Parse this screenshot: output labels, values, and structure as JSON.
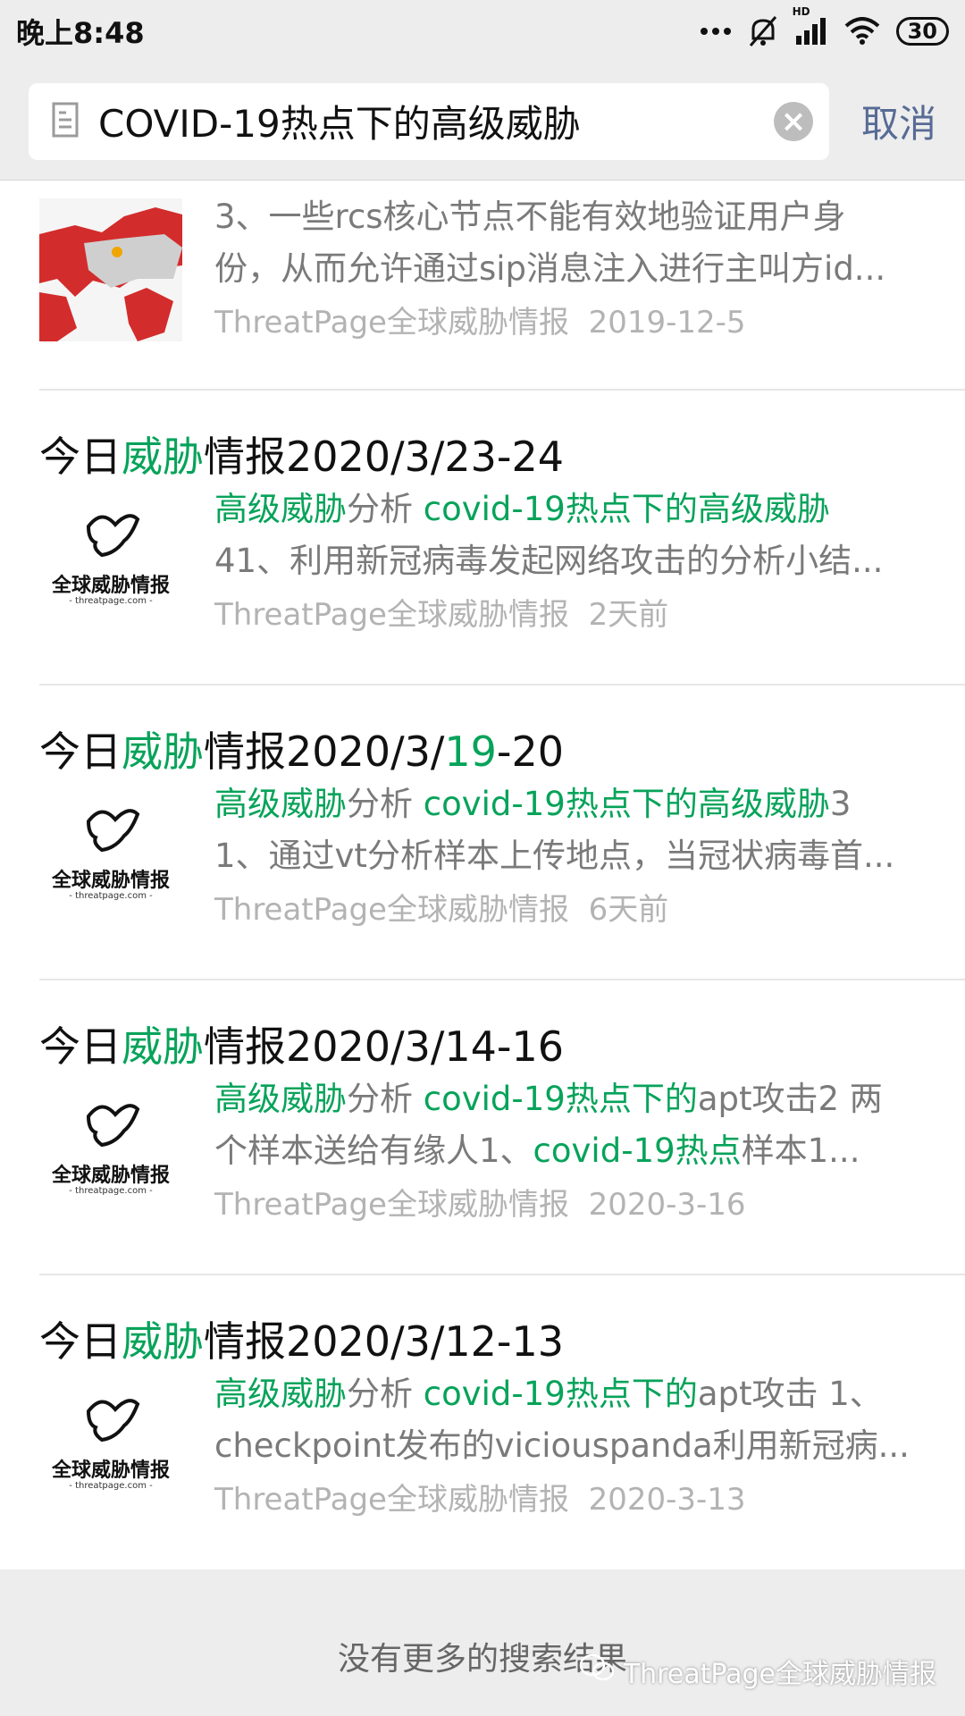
{
  "status": {
    "time": "晚上8:48",
    "battery": "30",
    "hd": "HD"
  },
  "search": {
    "query": "COVID-19热点下的高级威胁",
    "cancel": "取消"
  },
  "results": [
    {
      "line1": "3、一些rcs核心节点不能有效地验证用户身",
      "line2": "份，从而允许通过sip消息注入进行主叫方id...",
      "source": "ThreatPage全球威胁情报",
      "date": "2019-12-5"
    },
    {
      "title_pre": "今日",
      "title_hl": "威胁",
      "title_post": "情报2020/3/23-24",
      "l1_hl": "高级威胁",
      "l1_mid": "分析 ",
      "l1_hl2": "covid-19热点下的高级威胁",
      "line2": "41、利用新冠病毒发起网络攻击的分析小结...",
      "source": "ThreatPage全球威胁情报",
      "date": "2天前"
    },
    {
      "title_pre": "今日",
      "title_hl": "威胁",
      "title_mid": "情报2020/3/",
      "title_hl2": "19",
      "title_post": "-20",
      "l1_hl": "高级威胁",
      "l1_mid": "分析 ",
      "l1_hl2": "covid-19热点下的高级威胁",
      "l1_post": "3",
      "line2": "1、通过vt分析样本上传地点，当冠状病毒首...",
      "source": "ThreatPage全球威胁情报",
      "date": "6天前"
    },
    {
      "title_pre": "今日",
      "title_hl": "威胁",
      "title_post": "情报2020/3/14-16",
      "l1_hl": "高级威胁",
      "l1_mid": "分析 ",
      "l1_hl2": "covid-19热点下的",
      "l1_post": "apt攻击2 两",
      "l2_pre": "个样本送给有缘人1、",
      "l2_hl": "covid-19热点",
      "l2_post": "样本1...",
      "source": "ThreatPage全球威胁情报",
      "date": "2020-3-16"
    },
    {
      "title_pre": "今日",
      "title_hl": "威胁",
      "title_post": "情报2020/3/12-13",
      "l1_hl": "高级威胁",
      "l1_mid": "分析 ",
      "l1_hl2": "covid-19热点下的",
      "l1_post": "apt攻击 1、",
      "line2": "checkpoint发布的viciouspanda利用新冠病...",
      "source": "ThreatPage全球威胁情报",
      "date": "2020-3-13"
    }
  ],
  "logo": {
    "name": "全球威胁情报",
    "url": "- threatpage.com -"
  },
  "footer": {
    "message": "没有更多的搜索结果",
    "watermark": "ThreatPage全球威胁情报"
  },
  "colors": {
    "highlight": "#07a35a",
    "link": "#576b95"
  }
}
